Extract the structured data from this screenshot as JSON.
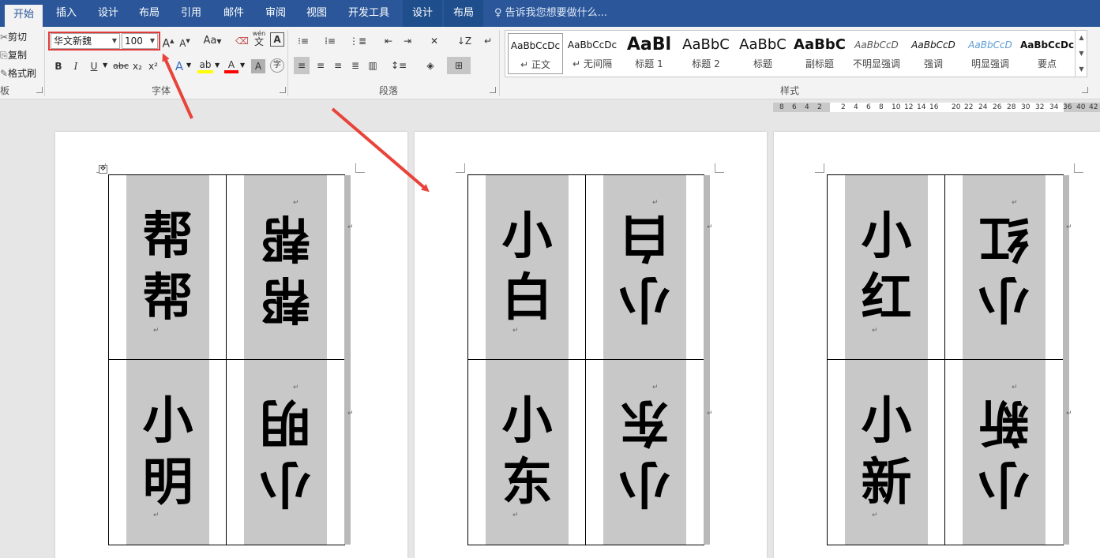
{
  "tabs": [
    {
      "label": "开始",
      "state": "active"
    },
    {
      "label": "插入"
    },
    {
      "label": "设计"
    },
    {
      "label": "布局"
    },
    {
      "label": "引用"
    },
    {
      "label": "邮件"
    },
    {
      "label": "审阅"
    },
    {
      "label": "视图"
    },
    {
      "label": "开发工具"
    },
    {
      "label": "设计",
      "state": "contextual"
    },
    {
      "label": "布局",
      "state": "contextual"
    }
  ],
  "tell_me": "告诉我您想要做什么...",
  "clipboard": {
    "cut": "剪切",
    "copy": "复制",
    "format_painter": "格式刷",
    "group_label": "板"
  },
  "font": {
    "name": "华文新魏",
    "size": "100",
    "grow_label": "A",
    "shrink_label": "A",
    "case_label": "Aa",
    "bold": "B",
    "italic": "I",
    "underline": "U",
    "strike": "abc",
    "subscript": "x₂",
    "superscript": "x²",
    "effects": "A",
    "font_color": "A",
    "char_shade": "A",
    "enclose": "字",
    "phonetic": "wén",
    "group_label": "字体"
  },
  "paragraph": {
    "group_label": "段落"
  },
  "styles": {
    "items": [
      {
        "preview": "AaBbCcDc",
        "name": "正文",
        "mark": "↵"
      },
      {
        "preview": "AaBbCcDc",
        "name": "无间隔",
        "mark": "↵"
      },
      {
        "preview": "AaBl",
        "name": "标题 1"
      },
      {
        "preview": "AaBbC",
        "name": "标题 2"
      },
      {
        "preview": "AaBbC",
        "name": "标题"
      },
      {
        "preview": "AaBbC",
        "name": "副标题"
      },
      {
        "preview": "AaBbCcD",
        "name": "不明显强调"
      },
      {
        "preview": "AaBbCcD",
        "name": "强调"
      },
      {
        "preview": "AaBbCcD",
        "name": "明显强调"
      },
      {
        "preview": "AaBbCcDc",
        "name": "要点"
      }
    ],
    "group_label": "样式"
  },
  "ruler": [
    "8",
    "6",
    "4",
    "2",
    "2",
    "4",
    "6",
    "8",
    "10",
    "12",
    "14",
    "16",
    "20",
    "22",
    "24",
    "26",
    "28",
    "30",
    "32",
    "34",
    "36",
    "40",
    "42"
  ],
  "pages": [
    {
      "cards": [
        {
          "top": [
            "帮",
            "帮"
          ],
          "bottom": [
            "帮",
            "帮"
          ]
        },
        {
          "top": [
            "小",
            "明"
          ],
          "bottom": [
            "小",
            "明"
          ]
        }
      ]
    },
    {
      "cards": [
        {
          "top": [
            "小",
            "白"
          ],
          "bottom": [
            "小",
            "白"
          ]
        },
        {
          "top": [
            "小",
            "东"
          ],
          "bottom": [
            "小",
            "东"
          ]
        }
      ]
    },
    {
      "cards": [
        {
          "top": [
            "小",
            "红"
          ],
          "bottom": [
            "小",
            "红"
          ]
        },
        {
          "top": [
            "小",
            "新"
          ],
          "bottom": [
            "小",
            "新"
          ]
        }
      ]
    }
  ],
  "colors": {
    "tab_bar": "#2b579a",
    "highlight": "#e03c3c",
    "cell_shade": "#c8c8c8"
  }
}
